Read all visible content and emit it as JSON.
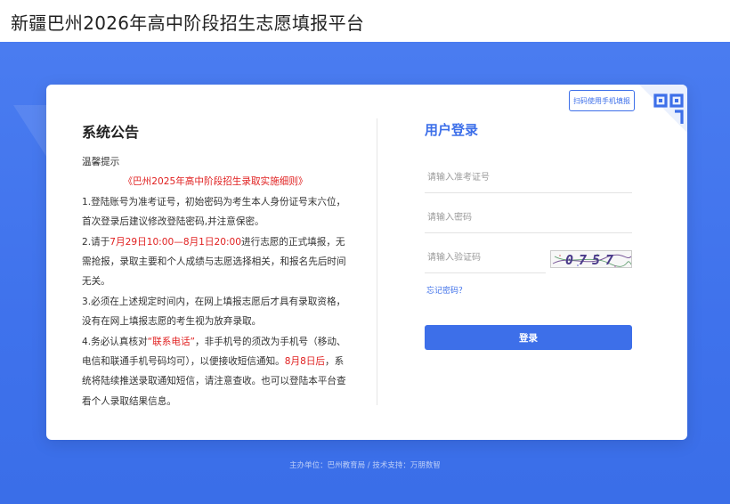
{
  "header": {
    "title": "新疆巴州2026年高中阶段招生志愿填报平台"
  },
  "notice": {
    "title": "系统公告",
    "greeting": "温馨提示",
    "rules_link": "《巴州2025年高中阶段招生录取实施细则》",
    "item1": "1.登陆账号为准考证号，初始密码为考生本人身份证号末六位，首次登录后建议修改登陆密码,并注意保密。",
    "item2_prefix": "2.请于",
    "item2_highlight": "7月29日10:00—8月1日20:00",
    "item2_suffix": "进行志愿的正式填报，无需抢报，录取主要和个人成绩与志愿选择相关，和报名先后时间无关。",
    "item3": "3.必须在上述规定时间内，在网上填报志愿后才具有录取资格，没有在网上填报志愿的考生视为放弃录取。",
    "item4_prefix": "4.务必认真核对",
    "item4_highlight1": "“联系电话”",
    "item4_middle": "，非手机号的须改为手机号（移动、电信和联通手机号码均可），以便接收短信通知。",
    "item4_highlight2": "8月8日后",
    "item4_suffix": "，系统将陆续推送录取通知短信，请注意查收。也可以登陆本平台查看个人录取结果信息。"
  },
  "login": {
    "title": "用户登录",
    "exam_id_placeholder": "请输入准考证号",
    "password_placeholder": "请输入密码",
    "captcha_placeholder": "请输入验证码",
    "captcha_text": "0757",
    "forgot_password": "忘记密码？",
    "submit": "登录",
    "qr_tip": "扫码使用手机填报"
  },
  "footer": {
    "text": "主办单位：巴州教育局 / 技术支持：万朋数智"
  },
  "colors": {
    "accent": "#3d6fe9",
    "highlight": "#e02020",
    "background": "#4a7cf0"
  },
  "icons": {
    "qr_corner": "qr-code-icon"
  }
}
